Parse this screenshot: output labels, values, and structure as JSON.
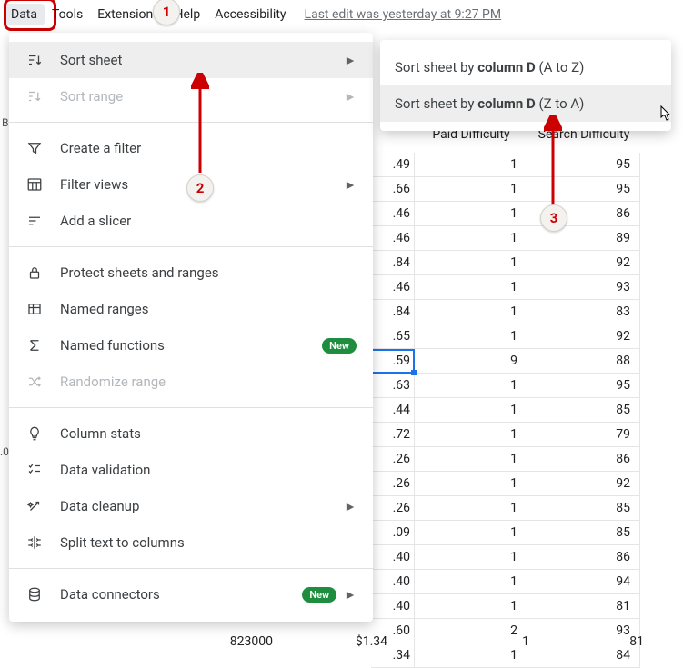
{
  "menubar": {
    "data": "Data",
    "tools": "Tools",
    "extensions": "Extensions",
    "help": "Help",
    "accessibility": "Accessibility",
    "last_edit": "Last edit was yesterday at 9:27 PM"
  },
  "steps": {
    "s1": "1",
    "s2": "2",
    "s3": "3"
  },
  "dropdown": {
    "sort_sheet": "Sort sheet",
    "sort_range": "Sort range",
    "create_filter": "Create a filter",
    "filter_views": "Filter views",
    "add_slicer": "Add a slicer",
    "protect": "Protect sheets and ranges",
    "named_ranges": "Named ranges",
    "named_functions": "Named functions",
    "new_badge": "New",
    "randomize": "Randomize range",
    "column_stats": "Column stats",
    "data_validation": "Data validation",
    "data_cleanup": "Data cleanup",
    "split_text": "Split text to columns",
    "data_connectors": "Data connectors"
  },
  "submenu": {
    "sort_az_pre": "Sort sheet by ",
    "sort_col": "column D",
    "sort_az_suf": " (A to Z)",
    "sort_za_suf": " (Z to A)"
  },
  "sheet": {
    "headers": {
      "paid": "Paid Difficulty",
      "search": "Search Difficulty"
    },
    "rows": [
      {
        "v": ".49",
        "pd": "1",
        "sd": "95"
      },
      {
        "v": ".66",
        "pd": "1",
        "sd": "95"
      },
      {
        "v": ".46",
        "pd": "1",
        "sd": "86"
      },
      {
        "v": ".46",
        "pd": "1",
        "sd": "89"
      },
      {
        "v": ".84",
        "pd": "1",
        "sd": "92"
      },
      {
        "v": ".46",
        "pd": "1",
        "sd": "93"
      },
      {
        "v": ".84",
        "pd": "1",
        "sd": "83"
      },
      {
        "v": ".65",
        "pd": "1",
        "sd": "92"
      },
      {
        "v": ".59",
        "pd": "9",
        "sd": "88",
        "selected": true
      },
      {
        "v": ".63",
        "pd": "1",
        "sd": "95"
      },
      {
        "v": ".44",
        "pd": "1",
        "sd": "85"
      },
      {
        "v": ".72",
        "pd": "1",
        "sd": "79"
      },
      {
        "v": ".26",
        "pd": "1",
        "sd": "86"
      },
      {
        "v": ".26",
        "pd": "1",
        "sd": "92"
      },
      {
        "v": ".26",
        "pd": "1",
        "sd": "85"
      },
      {
        "v": ".09",
        "pd": "1",
        "sd": "85"
      },
      {
        "v": ".40",
        "pd": "1",
        "sd": "86"
      },
      {
        "v": ".40",
        "pd": "1",
        "sd": "94"
      },
      {
        "v": ".40",
        "pd": "1",
        "sd": "81"
      },
      {
        "v": ".60",
        "pd": "2",
        "sd": "93"
      },
      {
        "v": ".34",
        "pd": "1",
        "sd": "84"
      }
    ],
    "bottom": {
      "a": "823000",
      "b": "$1.34",
      "c": "1",
      "d": "81"
    }
  },
  "gutter": {
    "b": "B",
    "zero": ".0"
  }
}
